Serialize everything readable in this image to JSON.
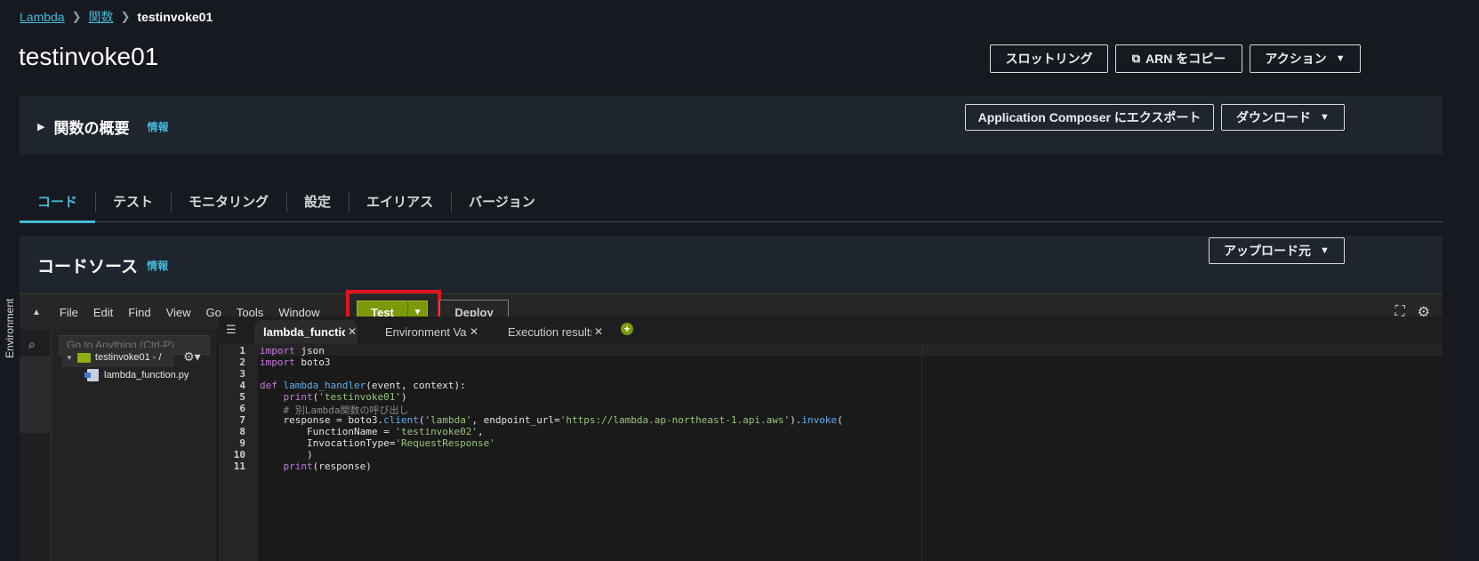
{
  "breadcrumb": {
    "root": "Lambda",
    "parent": "関数",
    "current": "testinvoke01"
  },
  "page_title": "testinvoke01",
  "header_buttons": {
    "throttle": "スロットリング",
    "copy_arn": "ARN をコピー",
    "actions": "アクション"
  },
  "overview": {
    "title": "関数の概要",
    "info": "情報",
    "export_button": "Application Composer にエクスポート",
    "download_button": "ダウンロード"
  },
  "tabs": [
    {
      "label": "コード",
      "active": true
    },
    {
      "label": "テスト"
    },
    {
      "label": "モニタリング"
    },
    {
      "label": "設定"
    },
    {
      "label": "エイリアス"
    },
    {
      "label": "バージョン"
    }
  ],
  "code_source": {
    "title": "コードソース",
    "info": "情報",
    "upload_button": "アップロード元"
  },
  "ide": {
    "menu": [
      "File",
      "Edit",
      "Find",
      "View",
      "Go",
      "Tools",
      "Window"
    ],
    "test_button": "Test",
    "deploy_button": "Deploy",
    "goto_placeholder": "Go to Anything (Ctrl-P)",
    "environment_label": "Environment",
    "tree_root": "testinvoke01 - /",
    "tree_file": "lambda_function.py",
    "editor_tabs": [
      "lambda_function",
      "Environment Vari",
      "Execution results"
    ],
    "highlight_color": "#e0141e",
    "accent_color": "#7a9a0c"
  },
  "code_lines": [
    "import json",
    "import boto3",
    "",
    "def lambda_handler(event, context):",
    "    print('testinvoke01')",
    "    # 別Lambda関数の呼び出し",
    "    response = boto3.client('lambda', endpoint_url='https://lambda.ap-northeast-1.api.aws').invoke(",
    "        FunctionName = 'testinvoke02',",
    "        InvocationType='RequestResponse'",
    "        )",
    "    print(response)"
  ],
  "line_numbers": [
    "1",
    "2",
    "3",
    "4",
    "5",
    "6",
    "7",
    "8",
    "9",
    "10",
    "11"
  ]
}
